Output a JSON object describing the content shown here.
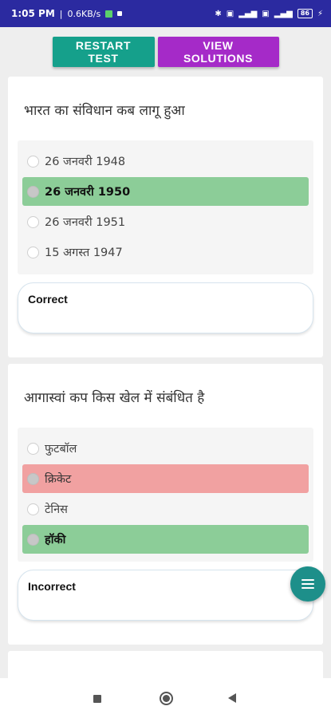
{
  "status_bar": {
    "time": "1:05 PM",
    "speed": "0.6KB/s",
    "battery": "86"
  },
  "toolbar": {
    "restart_label": "RESTART TEST",
    "solutions_label": "VIEW SOLUTIONS"
  },
  "colors": {
    "restart": "#15a08b",
    "solutions": "#a52ac8",
    "correct_option": "#8ccd98",
    "wrong_option": "#f1a1a1",
    "fab": "#1d8f8a"
  },
  "questions": [
    {
      "text": "भारत का संविधान कब लागू हुआ",
      "options": [
        {
          "label": "26 जनवरी 1948",
          "state": "normal"
        },
        {
          "label": "26 जनवरी 1950",
          "state": "correct"
        },
        {
          "label": "26 जनवरी 1951",
          "state": "normal"
        },
        {
          "label": "15 अगस्त 1947",
          "state": "normal"
        }
      ],
      "result": "Correct"
    },
    {
      "text": "आगास्वां कप किस खेल में संबंधित है",
      "options": [
        {
          "label": "फुटबॉल",
          "state": "normal"
        },
        {
          "label": "क्रिकेट",
          "state": "wrong"
        },
        {
          "label": "टेनिस",
          "state": "normal"
        },
        {
          "label": "हॉकी",
          "state": "correct"
        }
      ],
      "result": "Incorrect"
    }
  ],
  "icons": {
    "fab": "menu-icon",
    "nav": [
      "recents-icon",
      "home-icon",
      "back-icon"
    ]
  }
}
